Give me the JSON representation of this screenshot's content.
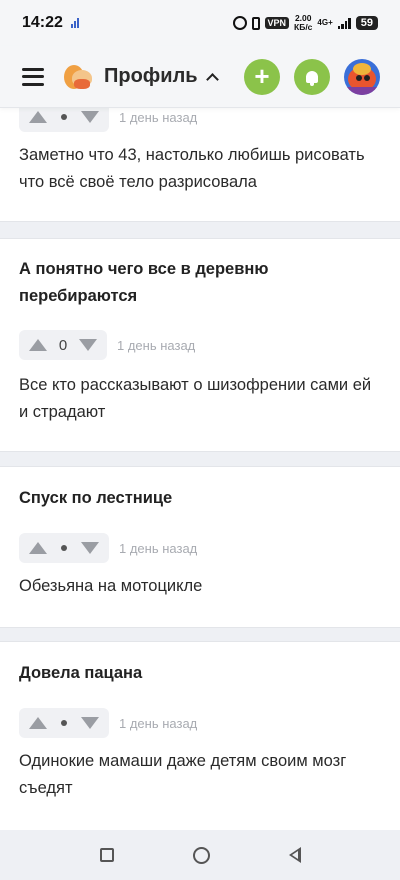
{
  "status_bar": {
    "time": "14:22",
    "vpn": "VPN",
    "speed_value": "2.00",
    "speed_unit": "КБ/с",
    "network": "4G+",
    "battery": "59"
  },
  "header": {
    "title": "Профиль",
    "icons": [
      "menu-icon",
      "app-logo",
      "chevron-up-icon",
      "plus-icon",
      "bell-icon",
      "avatar"
    ],
    "accent_color": "#8bc34a"
  },
  "posts": [
    {
      "title": "",
      "score": "•",
      "time": "1 день назад",
      "body": "Заметно что 43, настолько любишь рисовать что всё своё тело разрисовала"
    },
    {
      "title": "А понятно чего все в деревню перебираются",
      "score": "0",
      "time": "1 день назад",
      "body": "Все кто рассказывают о шизофрении сами ей и страдают"
    },
    {
      "title": "Спуск по лестнице",
      "score": "•",
      "time": "1 день назад",
      "body": "Обезьяна на мотоцикле"
    },
    {
      "title": "Довела пацана",
      "score": "•",
      "time": "1 день назад",
      "body": "Одинокие мамаши даже детям своим мозг съедят"
    }
  ],
  "nav_bar": {
    "icons": [
      "recent-apps-icon",
      "home-icon",
      "back-icon"
    ]
  }
}
